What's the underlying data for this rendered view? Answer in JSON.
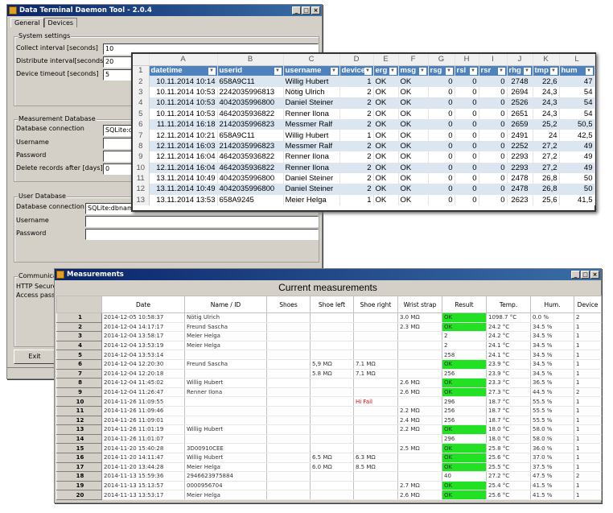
{
  "main_window": {
    "title": "Data Terminal Daemon Tool - 2.0.4",
    "tabs": [
      "General",
      "Devices"
    ],
    "system": {
      "title": "System settings",
      "collect_label": "Collect interval [seconds]",
      "collect_value": "10",
      "distribute_label": "Distribute interval[seconds]",
      "distribute_value": "20",
      "timeout_label": "Device timeout [seconds]",
      "timeout_value": "5"
    },
    "measurement_db": {
      "title": "Measurement Database",
      "connection_label": "Database connection",
      "connection_value": "SQLite:dbna",
      "username_label": "Username",
      "username_value": "",
      "password_label": "Password",
      "password_value": "",
      "delete_label": "Delete records after [days]",
      "delete_value": "0"
    },
    "user_db": {
      "title": "User Database",
      "connection_label": "Database connection",
      "connection_value": "SQLite:dbname=C",
      "username_label": "Username",
      "password_label": "Password"
    },
    "communication": {
      "title": "Communicati",
      "http_label": "HTTP Secure",
      "access_label": "Access passw"
    },
    "exit_label": "Exit"
  },
  "spreadsheet": {
    "col_letters": [
      "A",
      "B",
      "C",
      "D",
      "E",
      "F",
      "G",
      "H",
      "I",
      "J",
      "K",
      "L"
    ],
    "headers": [
      "datetime",
      "userid",
      "username",
      "device",
      "erg",
      "msg",
      "rsg",
      "rsl",
      "rsr",
      "rhg",
      "tmp",
      "hum"
    ],
    "rows": [
      [
        "10.11.2014 10:14",
        "658A9C11",
        "Willig Hubert",
        "1",
        "OK",
        "OK",
        "0",
        "0",
        "0",
        "2748",
        "22,6",
        "47"
      ],
      [
        "10.11.2014 10:53",
        "2242035996813",
        "Nötig Ulrich",
        "2",
        "OK",
        "OK",
        "0",
        "0",
        "0",
        "2694",
        "24,3",
        "54"
      ],
      [
        "10.11.2014 10:53",
        "4042035996800",
        "Daniel Steiner",
        "2",
        "OK",
        "OK",
        "0",
        "0",
        "0",
        "2526",
        "24,3",
        "54"
      ],
      [
        "10.11.2014 10:53",
        "4642035936822",
        "Renner Ilona",
        "2",
        "OK",
        "OK",
        "0",
        "0",
        "0",
        "2651",
        "24,3",
        "54"
      ],
      [
        "11.11.2014 16:18",
        "2142035996823",
        "Messmer Ralf",
        "2",
        "OK",
        "OK",
        "0",
        "0",
        "0",
        "2659",
        "25,2",
        "50,5"
      ],
      [
        "12.11.2014 10:21",
        "658A9C11",
        "Willig Hubert",
        "1",
        "OK",
        "OK",
        "0",
        "0",
        "0",
        "2491",
        "24",
        "42,5"
      ],
      [
        "12.11.2014 16:03",
        "2142035996823",
        "Messmer Ralf",
        "2",
        "OK",
        "OK",
        "0",
        "0",
        "0",
        "2252",
        "27,2",
        "49"
      ],
      [
        "12.11.2014 16:04",
        "4642035936822",
        "Renner Ilona",
        "2",
        "OK",
        "OK",
        "0",
        "0",
        "0",
        "2293",
        "27,2",
        "49"
      ],
      [
        "12.11.2014 16:04",
        "4642035936822",
        "Renner Ilona",
        "2",
        "OK",
        "OK",
        "0",
        "0",
        "0",
        "2293",
        "27,2",
        "49"
      ],
      [
        "13.11.2014 10:49",
        "4042035996800",
        "Daniel Steiner",
        "2",
        "OK",
        "OK",
        "0",
        "0",
        "0",
        "2478",
        "26,8",
        "50"
      ],
      [
        "13.11.2014 10:49",
        "4042035996800",
        "Daniel Steiner",
        "2",
        "OK",
        "OK",
        "0",
        "0",
        "0",
        "2478",
        "26,8",
        "50"
      ],
      [
        "13.11.2014 13:53",
        "658A9245",
        "Meier Helga",
        "1",
        "OK",
        "OK",
        "0",
        "0",
        "0",
        "2623",
        "25,6",
        "41,5"
      ]
    ]
  },
  "measurements": {
    "title": "Measurements",
    "heading": "Current measurements",
    "ok_color": "#22e022",
    "columns": [
      "",
      "Date",
      "Name / ID",
      "Shoes",
      "Shoe left",
      "Shoe right",
      "Wrist strap",
      "Result",
      "Temp.",
      "Hum.",
      "Device"
    ],
    "rows": [
      [
        "1",
        "2014-12-05 10:58:37",
        "Nötig Ulrich",
        "",
        "",
        "",
        "3.0 MΩ",
        "OK",
        "1098.7 °C",
        "0.0 %",
        "2"
      ],
      [
        "2",
        "2014-12-04 14:17:17",
        "Freund Sascha",
        "",
        "",
        "",
        "2.3 MΩ",
        "OK",
        "24.2 °C",
        "34.5 %",
        "1"
      ],
      [
        "3",
        "2014-12-04 13:58:17",
        "Meier Helga",
        "",
        "",
        "",
        "",
        "2",
        "24.2 °C",
        "34.5 %",
        "1"
      ],
      [
        "4",
        "2014-12-04 13:53:19",
        "Meier Helga",
        "",
        "",
        "",
        "",
        "2",
        "24.1 °C",
        "34.5 %",
        "1"
      ],
      [
        "5",
        "2014-12-04 13:53:14",
        "",
        "",
        "",
        "",
        "",
        "258",
        "24.1 °C",
        "34.5 %",
        "1"
      ],
      [
        "6",
        "2014-12-04 12:20:30",
        "Freund Sascha",
        "",
        "5,9 MΩ",
        "7.1 MΩ",
        "",
        "OK",
        "23.9 °C",
        "34.5 %",
        "1"
      ],
      [
        "7",
        "2014-12-04 12:20:18",
        "",
        "",
        "5.8 MΩ",
        "7.1 MΩ",
        "",
        "256",
        "23.9 °C",
        "34.5 %",
        "1"
      ],
      [
        "8",
        "2014-12-04 11:45:02",
        "Willig Hubert",
        "",
        "",
        "",
        "2.6 MΩ",
        "OK",
        "23.3 °C",
        "36.5 %",
        "1"
      ],
      [
        "9",
        "2014-12-04 11:26:47",
        "Renner Ilona",
        "",
        "",
        "",
        "2.6 MΩ",
        "OK",
        "27.3 °C",
        "44.5 %",
        "2"
      ],
      [
        "10",
        "2014-11-26 11:09:55",
        "",
        "",
        "",
        "Hi Fail",
        "",
        "296",
        "18.7 °C",
        "55.5 %",
        "1"
      ],
      [
        "11",
        "2014-11-26 11:09:46",
        "",
        "",
        "",
        "",
        "2.2 MΩ",
        "256",
        "18.7 °C",
        "55.5 %",
        "1"
      ],
      [
        "12",
        "2014-11-26 11:09:01",
        "",
        "",
        "",
        "",
        "2.4 MΩ",
        "256",
        "18.7 °C",
        "55.5 %",
        "1"
      ],
      [
        "13",
        "2014-11-26 11:01:19",
        "Willig Hubert",
        "",
        "",
        "",
        "2.2 MΩ",
        "OK",
        "18.0 °C",
        "58.0 %",
        "1"
      ],
      [
        "14",
        "2014-11-26 11:01:07",
        "",
        "",
        "",
        "",
        "",
        "296",
        "18.0 °C",
        "58.0 %",
        "1"
      ],
      [
        "15",
        "2014-11-20 15:40:28",
        "3D00910CEE",
        "",
        "",
        "",
        "2.5 MΩ",
        "OK",
        "25.8 °C",
        "36.0 %",
        "1"
      ],
      [
        "16",
        "2014-11-20 14:11:47",
        "Willig Hubert",
        "",
        "6.5 MΩ",
        "6.3 MΩ",
        "",
        "OK",
        "25.6 °C",
        "37.0 %",
        "1"
      ],
      [
        "17",
        "2014-11-20 13:44:28",
        "Meier Helga",
        "",
        "6.0 MΩ",
        "8.5 MΩ",
        "",
        "OK",
        "25.5 °C",
        "37.5 %",
        "1"
      ],
      [
        "18",
        "2014-11-13 15:59:36",
        "2946623975884",
        "",
        "",
        "",
        "",
        "40",
        "27.2 °C",
        "47.5 %",
        "2"
      ],
      [
        "19",
        "2014-11-13 15:13:57",
        "0000956704",
        "",
        "",
        "",
        "2.7 MΩ",
        "OK",
        "25.4 °C",
        "41.5 %",
        "1"
      ],
      [
        "20",
        "2014-11-13 13:53:17",
        "Meier Helga",
        "",
        "",
        "",
        "2.6 MΩ",
        "OK",
        "25.6 °C",
        "41.5 %",
        "1"
      ]
    ]
  }
}
